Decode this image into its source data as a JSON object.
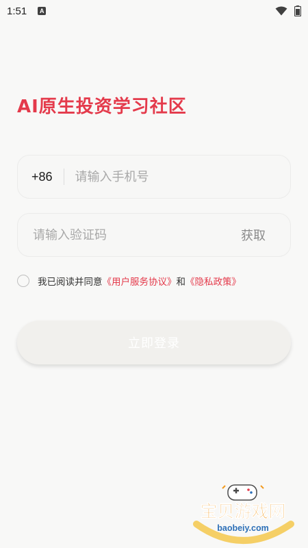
{
  "status_bar": {
    "time": "1:51",
    "notification_icon": "a-letter-icon",
    "wifi_icon": "wifi-icon",
    "battery_icon": "battery-icon"
  },
  "title": "AI原生投资学习社区",
  "phone": {
    "country_code": "+86",
    "placeholder": "请输入手机号",
    "value": ""
  },
  "code": {
    "placeholder": "请输入验证码",
    "value": "",
    "get_label": "获取"
  },
  "agreement": {
    "prefix": "我已阅读并同意",
    "user_agreement": "《用户服务协议》",
    "and": "和",
    "privacy_policy": "《隐私政策》",
    "checked": false
  },
  "login_button": "立即登录",
  "watermark": {
    "name": "宝贝游戏网",
    "url": "baobeiy.com"
  },
  "colors": {
    "accent": "#e43a4b",
    "background": "#f8f8f7",
    "watermark_orange": "#f29a1e",
    "watermark_blue": "#2c6fb7"
  }
}
